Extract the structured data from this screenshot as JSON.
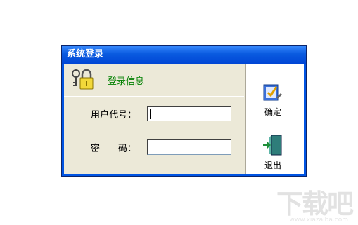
{
  "window": {
    "title": "系统登录"
  },
  "header": {
    "label": "登录信息",
    "icon": "keys-lock-icon"
  },
  "form": {
    "user_code_label": "用户代号：",
    "user_code_value": "",
    "password_label": "密　　码：",
    "password_value": ""
  },
  "buttons": {
    "ok_label": "确定",
    "ok_icon": "confirm-check-icon",
    "exit_label": "退出",
    "exit_icon": "exit-door-icon"
  },
  "colors": {
    "titlebar": "#0054e3",
    "header_text": "#008000",
    "panel": "#ece9d8"
  },
  "watermark": {
    "text": "下载吧",
    "url": "www.xiazaiba.com"
  }
}
